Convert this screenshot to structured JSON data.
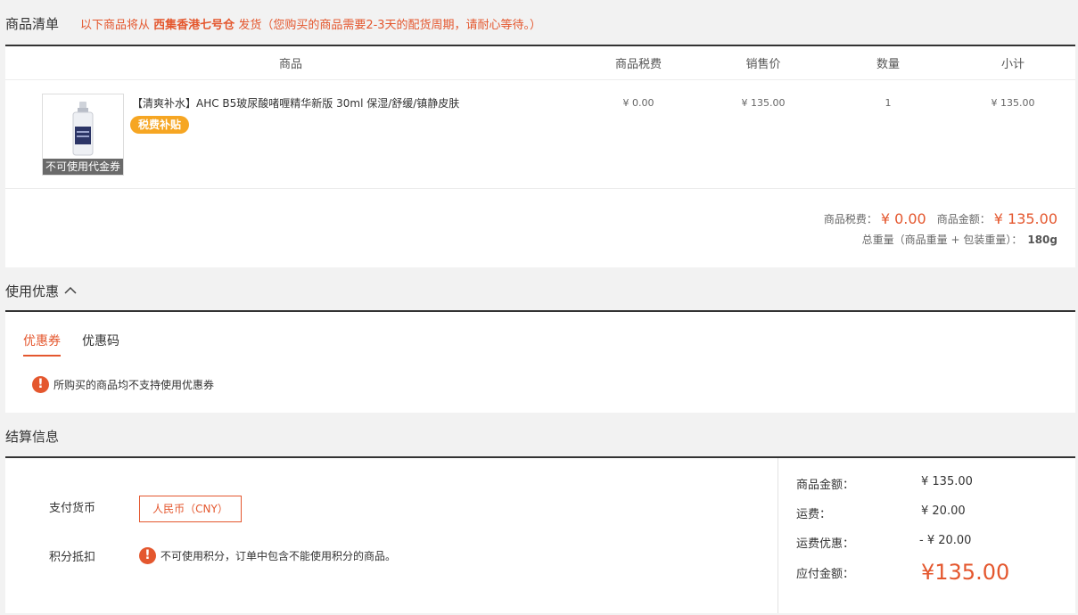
{
  "goods": {
    "section_title": "商品清单",
    "notice_prefix": "以下商品将从",
    "notice_warehouse": "西集香港七号仓",
    "notice_suffix": "发货（您购买的商品需要2-3天的配货周期，请耐心等待。）",
    "columns": [
      "商品",
      "商品税费",
      "销售价",
      "数量",
      "小计"
    ],
    "item": {
      "name": "【清爽补水】AHC B5玻尿酸啫喱精华新版 30ml 保湿/舒缓/镇静皮肤",
      "badge": "税费补贴",
      "thumb_tag": "不可使用代金券",
      "tax": "¥ 0.00",
      "price": "¥ 135.00",
      "qty": "1",
      "subtotal": "¥ 135.00"
    },
    "totals": {
      "tax_label": "商品税费：",
      "tax_value": "¥ 0.00",
      "amount_label": "商品金额：",
      "amount_value": "¥ 135.00",
      "weight_label": "总重量（商品重量 + 包装重量）：",
      "weight_value": "180g"
    }
  },
  "promo": {
    "section_title": "使用优惠",
    "tabs": [
      "优惠券",
      "优惠码"
    ],
    "warning": "所购买的商品均不支持使用优惠券"
  },
  "settle": {
    "section_title": "结算信息",
    "currency_label": "支付货币",
    "currency_value": "人民币（CNY）",
    "points_label": "积分抵扣",
    "points_warning": "不可使用积分，订单中包含不能使用积分的商品。",
    "summary": {
      "goods_label": "商品金额：",
      "goods_value": "¥ 135.00",
      "shipping_label": "运费：",
      "shipping_value": "¥ 20.00",
      "shipping_discount_label": "运费优惠：",
      "shipping_discount_value": "- ¥ 20.00",
      "pay_label": "应付金额：",
      "pay_value": "¥135.00"
    }
  },
  "colors": {
    "accent": "#e4572e",
    "badge": "#f6a623"
  }
}
